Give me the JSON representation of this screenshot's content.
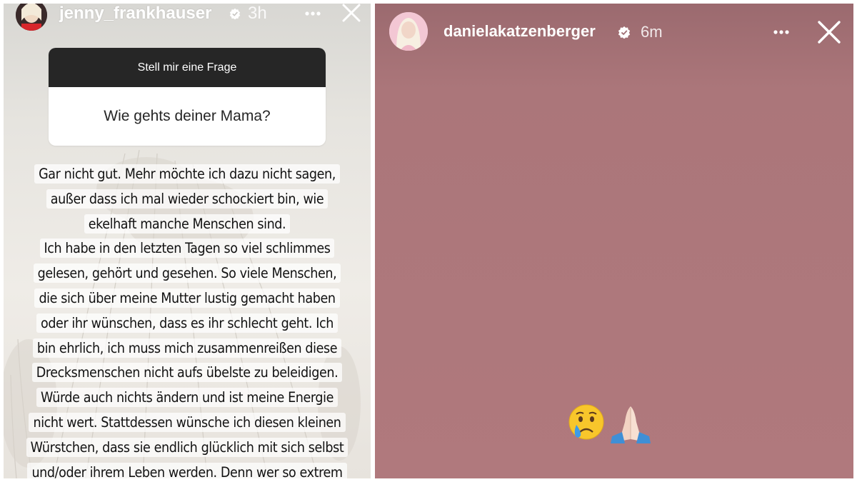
{
  "left_story": {
    "username": "jenny_frankhauser",
    "time": "3h",
    "verified": true,
    "question_sticker": {
      "header": "Stell mir eine Frage",
      "question": "Wie gehts deiner Mama?"
    },
    "answer_lines": [
      "Gar nicht gut. Mehr möchte ich dazu nicht sagen,",
      "außer dass ich mal wieder schockiert bin, wie",
      "ekelhaft manche Menschen sind.",
      "Ich habe in den letzten Tagen so viel schlimmes",
      "gelesen, gehört und gesehen. So viele Menschen,",
      "die sich über meine Mutter lustig gemacht haben",
      "oder ihr wünschen, dass es ihr schlecht geht. Ich",
      "bin ehrlich, ich muss mich zusammenreißen diese",
      "Drecksmenschen nicht aufs übelste zu beleidigen.",
      "Würde auch nichts ändern und ist meine Energie",
      "nicht wert. Stattdessen wünsche ich diesen kleinen",
      "Würstchen, dass sie endlich glücklich mit sich selbst",
      "und/oder ihrem Leben werden. Denn wer so extrem"
    ]
  },
  "right_story": {
    "username": "danielakatzenberger",
    "time": "6m",
    "verified": true,
    "emojis": [
      "crying-face",
      "folded-hands"
    ]
  },
  "colors": {
    "right_background": "#b0797d",
    "sticker_header": "#262626",
    "verified_badge": "#ffffff"
  }
}
